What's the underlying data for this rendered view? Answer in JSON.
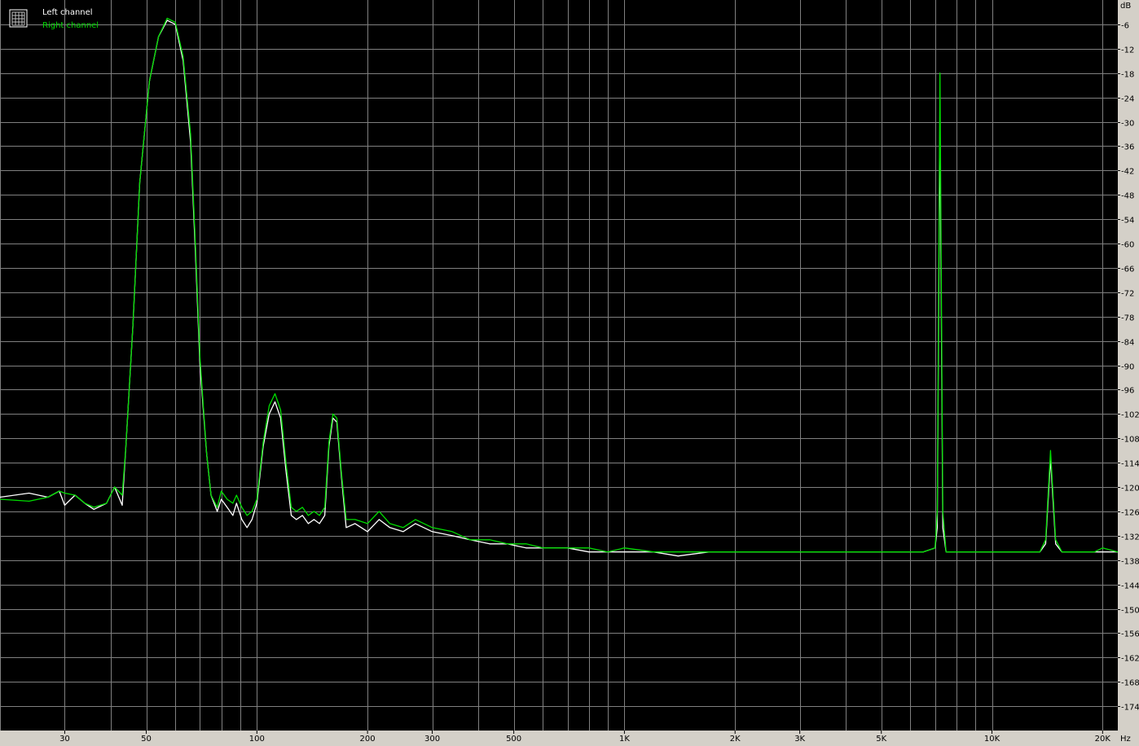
{
  "chart_data": {
    "type": "line",
    "title": "",
    "xlabel": "",
    "ylabel": "",
    "x_scale": "log",
    "xlim": [
      20,
      22000
    ],
    "ylim": [
      -180,
      0
    ],
    "x_unit_label": "Hz",
    "y_unit_label": "dB",
    "x_ticks": [
      {
        "value": 30,
        "label": "30"
      },
      {
        "value": 50,
        "label": "50"
      },
      {
        "value": 100,
        "label": "100"
      },
      {
        "value": 200,
        "label": "200"
      },
      {
        "value": 300,
        "label": "300"
      },
      {
        "value": 500,
        "label": "500"
      },
      {
        "value": 1000,
        "label": "1K"
      },
      {
        "value": 2000,
        "label": "2K"
      },
      {
        "value": 3000,
        "label": "3K"
      },
      {
        "value": 5000,
        "label": "5K"
      },
      {
        "value": 10000,
        "label": "10K"
      },
      {
        "value": 20000,
        "label": "20K"
      }
    ],
    "y_ticks": [
      -6,
      -12,
      -18,
      -24,
      -30,
      -36,
      -42,
      -48,
      -54,
      -60,
      -66,
      -72,
      -78,
      -84,
      -90,
      -96,
      -102,
      -108,
      -114,
      -120,
      -126,
      -132,
      -138,
      -144,
      -150,
      -156,
      -162,
      -168,
      -174
    ],
    "grid": true,
    "legend_position": "top-left",
    "colors": {
      "background": "#000000",
      "grid": "#808080",
      "axis_panel": "#d4d0c8",
      "left_channel": "#ffffff",
      "right_channel": "#00dd00"
    },
    "series": [
      {
        "name": "Left channel",
        "color": "#ffffff",
        "points": [
          [
            20,
            -122.5
          ],
          [
            24,
            -121.5
          ],
          [
            27,
            -122.5
          ],
          [
            29,
            -121
          ],
          [
            30,
            -124.5
          ],
          [
            32,
            -122
          ],
          [
            34,
            -124
          ],
          [
            36,
            -125.5
          ],
          [
            39,
            -124
          ],
          [
            41,
            -120
          ],
          [
            43,
            -124.5
          ],
          [
            44,
            -110
          ],
          [
            46,
            -80
          ],
          [
            48,
            -45
          ],
          [
            51,
            -20
          ],
          [
            54,
            -9
          ],
          [
            57,
            -5
          ],
          [
            60,
            -6
          ],
          [
            63,
            -15
          ],
          [
            66,
            -35
          ],
          [
            68,
            -62
          ],
          [
            70,
            -90
          ],
          [
            73,
            -112
          ],
          [
            75,
            -122
          ],
          [
            78,
            -126
          ],
          [
            80,
            -123
          ],
          [
            83,
            -125
          ],
          [
            86,
            -127
          ],
          [
            88,
            -124
          ],
          [
            91,
            -128
          ],
          [
            94,
            -130
          ],
          [
            97,
            -128
          ],
          [
            100,
            -124
          ],
          [
            104,
            -110
          ],
          [
            108,
            -102
          ],
          [
            112,
            -99
          ],
          [
            116,
            -103
          ],
          [
            120,
            -116
          ],
          [
            124,
            -127
          ],
          [
            128,
            -128
          ],
          [
            133,
            -127
          ],
          [
            138,
            -129
          ],
          [
            143,
            -128
          ],
          [
            148,
            -129
          ],
          [
            153,
            -127
          ],
          [
            157,
            -110
          ],
          [
            161,
            -103
          ],
          [
            165,
            -104
          ],
          [
            170,
            -118
          ],
          [
            175,
            -130
          ],
          [
            185,
            -129
          ],
          [
            200,
            -131
          ],
          [
            215,
            -128
          ],
          [
            230,
            -130
          ],
          [
            250,
            -131
          ],
          [
            270,
            -129
          ],
          [
            300,
            -131
          ],
          [
            340,
            -132
          ],
          [
            380,
            -133
          ],
          [
            430,
            -134
          ],
          [
            480,
            -134
          ],
          [
            540,
            -135
          ],
          [
            600,
            -135
          ],
          [
            700,
            -135
          ],
          [
            800,
            -136
          ],
          [
            900,
            -136
          ],
          [
            1000,
            -136
          ],
          [
            1200,
            -136
          ],
          [
            1400,
            -137
          ],
          [
            1700,
            -136
          ],
          [
            2000,
            -136
          ],
          [
            2500,
            -136
          ],
          [
            3000,
            -136
          ],
          [
            3500,
            -136
          ],
          [
            4000,
            -136
          ],
          [
            5000,
            -136
          ],
          [
            6000,
            -136
          ],
          [
            6500,
            -136
          ],
          [
            7000,
            -135
          ],
          [
            7100,
            -130
          ],
          [
            7220,
            -29
          ],
          [
            7350,
            -130
          ],
          [
            7500,
            -136
          ],
          [
            8000,
            -136
          ],
          [
            9000,
            -136
          ],
          [
            10000,
            -136
          ],
          [
            12000,
            -136
          ],
          [
            13500,
            -136
          ],
          [
            14000,
            -134
          ],
          [
            14430,
            -113
          ],
          [
            14900,
            -134
          ],
          [
            15500,
            -136
          ],
          [
            17000,
            -136
          ],
          [
            19000,
            -136
          ],
          [
            20000,
            -136
          ],
          [
            22000,
            -136
          ]
        ]
      },
      {
        "name": "Right channel",
        "color": "#00dd00",
        "points": [
          [
            20,
            -123
          ],
          [
            24,
            -123.5
          ],
          [
            27,
            -122.5
          ],
          [
            29,
            -121
          ],
          [
            30,
            -121.5
          ],
          [
            32,
            -122
          ],
          [
            34,
            -124
          ],
          [
            36,
            -125
          ],
          [
            39,
            -124
          ],
          [
            41,
            -120
          ],
          [
            43,
            -122
          ],
          [
            44,
            -110
          ],
          [
            46,
            -80
          ],
          [
            48,
            -45
          ],
          [
            51,
            -20
          ],
          [
            54,
            -9
          ],
          [
            57,
            -4.5
          ],
          [
            60,
            -5.5
          ],
          [
            63,
            -14
          ],
          [
            66,
            -33
          ],
          [
            68,
            -60
          ],
          [
            70,
            -88
          ],
          [
            73,
            -112
          ],
          [
            75,
            -122
          ],
          [
            78,
            -125
          ],
          [
            80,
            -121
          ],
          [
            83,
            -123
          ],
          [
            86,
            -124
          ],
          [
            88,
            -122
          ],
          [
            91,
            -125
          ],
          [
            94,
            -127
          ],
          [
            97,
            -126
          ],
          [
            100,
            -123
          ],
          [
            104,
            -109
          ],
          [
            108,
            -100
          ],
          [
            112,
            -97
          ],
          [
            116,
            -101
          ],
          [
            120,
            -114
          ],
          [
            124,
            -125
          ],
          [
            128,
            -126
          ],
          [
            133,
            -125
          ],
          [
            138,
            -127
          ],
          [
            143,
            -126
          ],
          [
            148,
            -127
          ],
          [
            153,
            -125
          ],
          [
            157,
            -109
          ],
          [
            161,
            -102
          ],
          [
            165,
            -103
          ],
          [
            170,
            -117
          ],
          [
            175,
            -128
          ],
          [
            185,
            -128
          ],
          [
            200,
            -129
          ],
          [
            215,
            -126
          ],
          [
            230,
            -129
          ],
          [
            250,
            -130
          ],
          [
            270,
            -128
          ],
          [
            300,
            -130
          ],
          [
            340,
            -131
          ],
          [
            380,
            -133
          ],
          [
            430,
            -133
          ],
          [
            480,
            -134
          ],
          [
            540,
            -134
          ],
          [
            600,
            -135
          ],
          [
            700,
            -135
          ],
          [
            800,
            -135
          ],
          [
            900,
            -136
          ],
          [
            1000,
            -135
          ],
          [
            1200,
            -136
          ],
          [
            1400,
            -136
          ],
          [
            1700,
            -136
          ],
          [
            2000,
            -136
          ],
          [
            2500,
            -136
          ],
          [
            3000,
            -136
          ],
          [
            3500,
            -136
          ],
          [
            4000,
            -136
          ],
          [
            5000,
            -136
          ],
          [
            6000,
            -136
          ],
          [
            6500,
            -136
          ],
          [
            7000,
            -135
          ],
          [
            7100,
            -126
          ],
          [
            7220,
            -18
          ],
          [
            7350,
            -126
          ],
          [
            7500,
            -136
          ],
          [
            8000,
            -136
          ],
          [
            9000,
            -136
          ],
          [
            10000,
            -136
          ],
          [
            12000,
            -136
          ],
          [
            13500,
            -136
          ],
          [
            14000,
            -133
          ],
          [
            14430,
            -111
          ],
          [
            14900,
            -133
          ],
          [
            15500,
            -136
          ],
          [
            17000,
            -136
          ],
          [
            19000,
            -136
          ],
          [
            20000,
            -135
          ],
          [
            22000,
            -136
          ]
        ]
      }
    ]
  }
}
